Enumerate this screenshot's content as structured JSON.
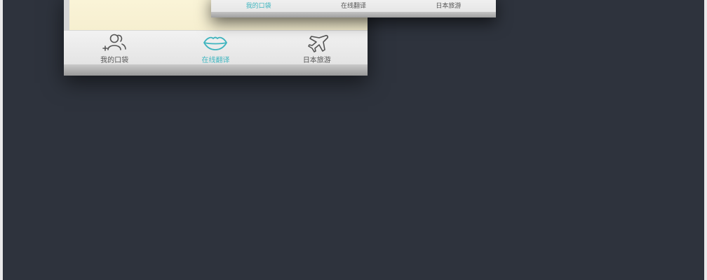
{
  "colors": {
    "background": "#2e333d",
    "accent": "#3fb5bf",
    "label": "#555555",
    "cream": "#fbf5d9"
  },
  "back_card": {
    "tabs": [
      {
        "label": "我的口袋",
        "icon": "add-user-icon",
        "active": false
      },
      {
        "label": "在线翻译",
        "icon": "lips-icon",
        "active": true
      },
      {
        "label": "日本旅游",
        "icon": "airplane-icon",
        "active": false
      }
    ]
  },
  "front_card": {
    "tabs": [
      {
        "label": "我的口袋",
        "active": true
      },
      {
        "label": "在线翻译",
        "active": false
      },
      {
        "label": "日本旅游",
        "active": false
      }
    ]
  }
}
